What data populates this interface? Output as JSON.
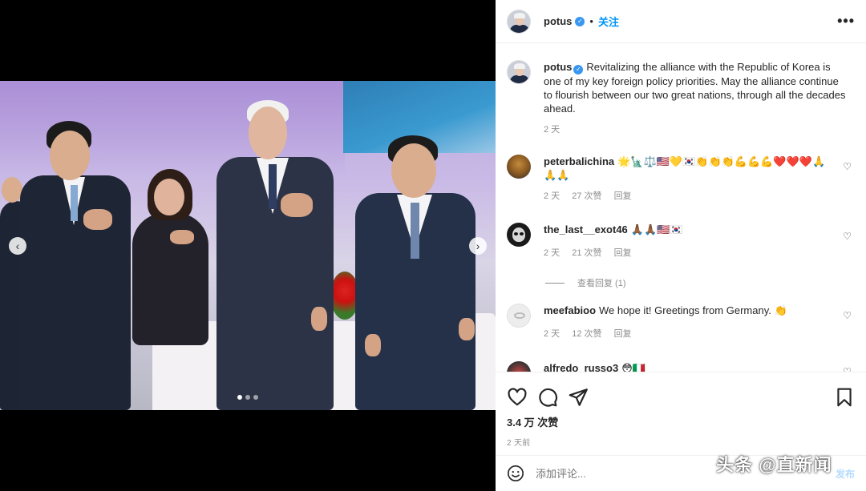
{
  "post": {
    "username": "potus",
    "follow_label": "关注",
    "separator": "•",
    "more_label": "•••",
    "caption_user": "potus",
    "caption_text": "Revitalizing the alliance with the Republic of Korea is one of my key foreign policy priorities. May the alliance continue to flourish between our two great nations, through all the decades ahead.",
    "caption_time": "2 天"
  },
  "comments": [
    {
      "user": "peterbalichina",
      "text": "🌟🗽⚖️🇺🇸💛🇰🇷👏👏👏💪💪💪❤️❤️❤️🙏🙏🙏",
      "time": "2 天",
      "likes": "27 次赞",
      "reply": "回复"
    },
    {
      "user": "the_last__exot46",
      "text": "🙏🏾🙏🏾🇺🇸🇰🇷",
      "time": "2 天",
      "likes": "21 次赞",
      "reply": "回复",
      "view_replies": "查看回复 (1)"
    },
    {
      "user": "meefabioo",
      "text": "We hope it! Greetings from Germany. 👏",
      "time": "2 天",
      "likes": "12 次赞",
      "reply": "回复"
    },
    {
      "user": "alfredo_russo3",
      "text": "😳🇮🇹"
    }
  ],
  "stats": {
    "likes": "3.4 万 次赞",
    "posted_ago": "2 天前"
  },
  "composer": {
    "placeholder": "添加评论...",
    "post_label": "发布"
  },
  "carousel": {
    "prev": "‹",
    "next": "›",
    "slide_count": 3,
    "active_slide": 1
  },
  "watermark": "头条 @直新闻",
  "colors": {
    "accent": "#0095f6",
    "verified": "#3897f0",
    "muted": "#8e8e8e"
  }
}
